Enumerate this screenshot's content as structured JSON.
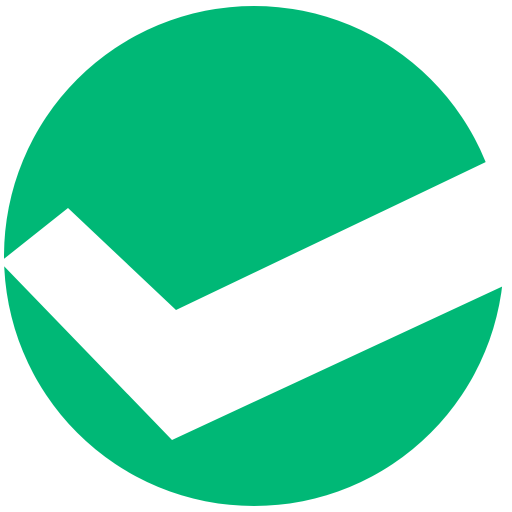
{
  "icon": {
    "name": "check-circle-icon",
    "style": "check mark cutting out of a circle",
    "colors": {
      "circle": "#00B876",
      "check": "#ffffff",
      "background": "#ffffff"
    }
  }
}
